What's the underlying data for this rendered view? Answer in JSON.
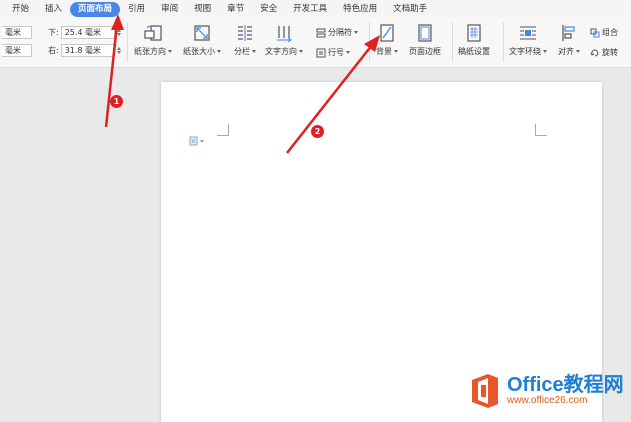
{
  "tabs": [
    "开始",
    "插入",
    "页面布局",
    "引用",
    "审阅",
    "视图",
    "章节",
    "安全",
    "开发工具",
    "特色应用",
    "文档助手"
  ],
  "active_tab_index": 2,
  "margins": {
    "left_unit": "毫米",
    "left_unit2": "毫米",
    "bottom_label": "下:",
    "bottom_value": "25.4 毫米",
    "right_label": "右:",
    "right_value": "31.8 毫米"
  },
  "ribbon": {
    "orientation": "纸张方向",
    "size": "纸张大小",
    "columns": "分栏",
    "text_direction": "文字方向",
    "breaks": "分隔符",
    "line_numbers": "行号",
    "background": "背景",
    "page_border": "页面边框",
    "manuscript": "稿纸设置",
    "wrap": "文字环绕",
    "align": "对齐",
    "group": "组合",
    "rotate": "旋转"
  },
  "annotations": {
    "badge1": "1",
    "badge2": "2"
  },
  "colors": {
    "accent": "#4a86e8",
    "arrow": "#e02020"
  },
  "watermark": {
    "line1": "Office教程网",
    "line2": "www.office26.com"
  }
}
